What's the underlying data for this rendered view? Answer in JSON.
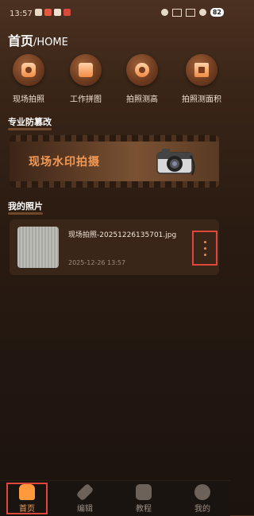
{
  "status": {
    "time": "13:57",
    "battery": "82"
  },
  "header": {
    "title": "首页",
    "subtitle": "/HOME"
  },
  "quick_actions": [
    {
      "label": "现场拍照",
      "icon": "camera-icon"
    },
    {
      "label": "工作拼图",
      "icon": "puzzle-icon"
    },
    {
      "label": "拍照测高",
      "icon": "measure-height-icon"
    },
    {
      "label": "拍照测面积",
      "icon": "area-icon"
    }
  ],
  "sections": {
    "anti_tamper": "专业防篡改",
    "my_photos": "我的照片"
  },
  "banner": {
    "text": "现场水印拍摄"
  },
  "photos": [
    {
      "filename": "现场拍照-20251226135701.jpg",
      "date": "2025-12-26 13:57"
    }
  ],
  "tabs": [
    {
      "label": "首页",
      "active": true
    },
    {
      "label": "编辑",
      "active": false
    },
    {
      "label": "教程",
      "active": false
    },
    {
      "label": "我的",
      "active": false
    }
  ],
  "colors": {
    "accent": "#f2a15d",
    "highlight": "#e0463a"
  }
}
